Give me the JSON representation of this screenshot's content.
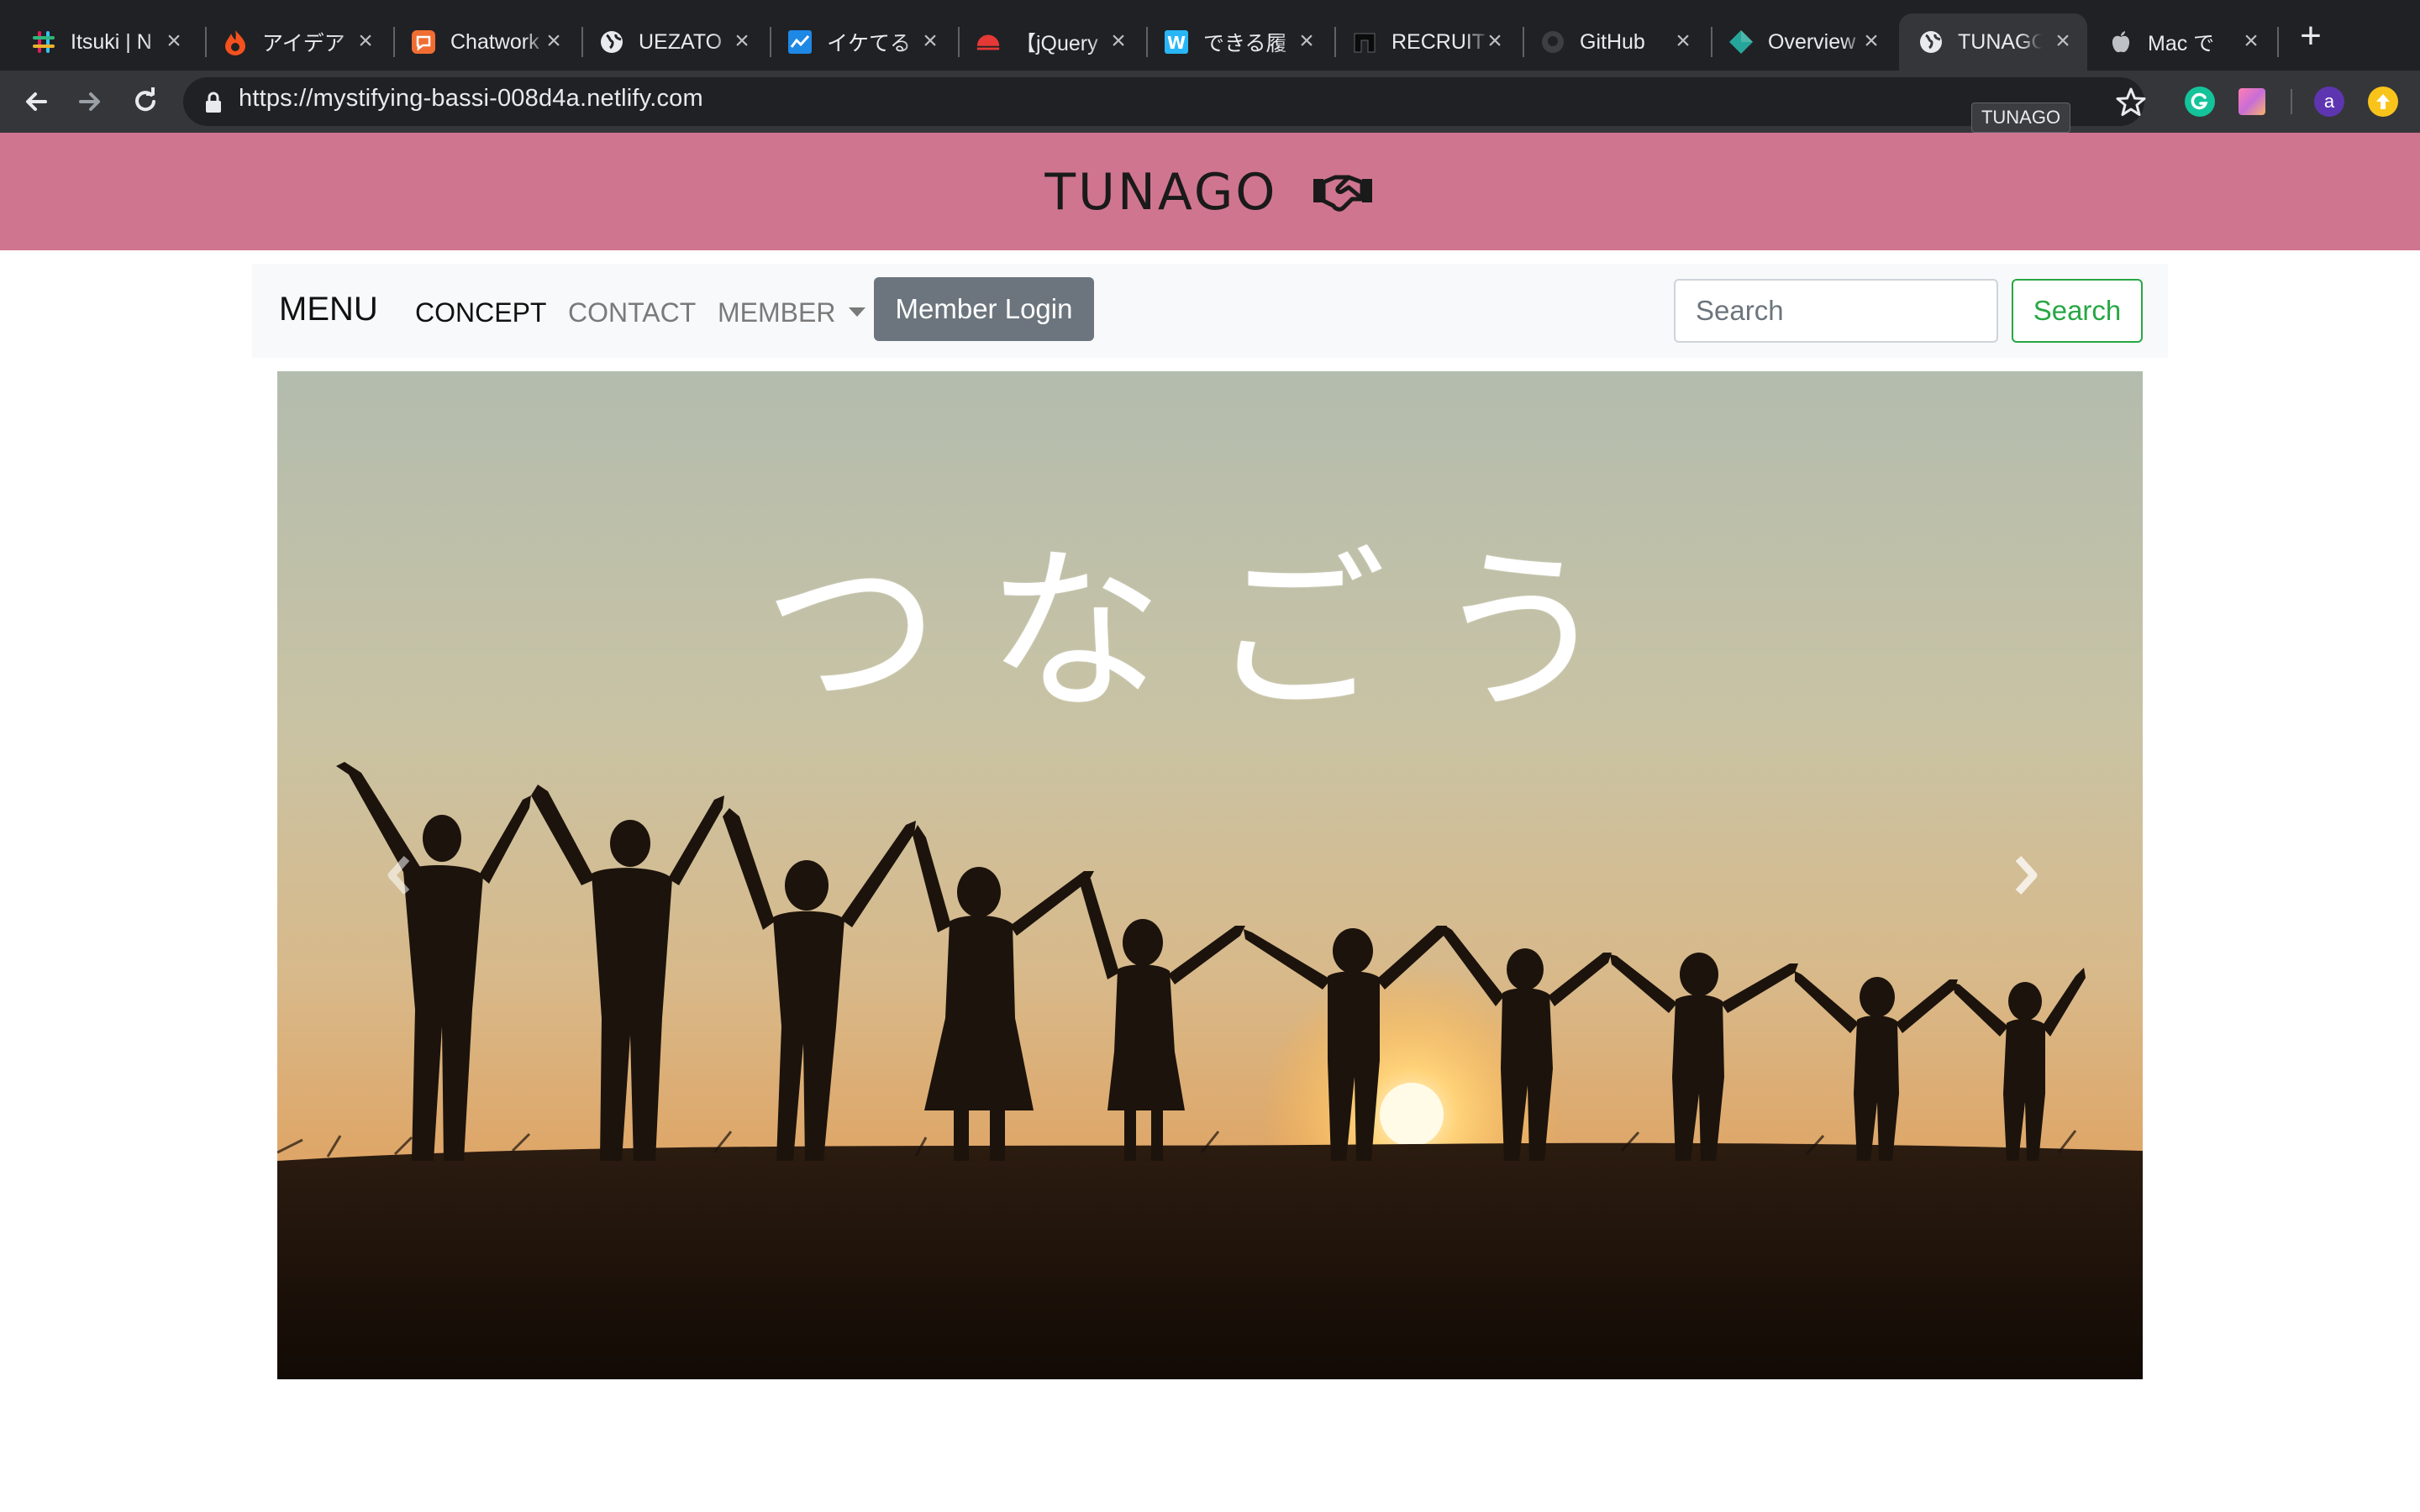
{
  "browser": {
    "tabs": [
      {
        "title": "Itsuki | N",
        "icon": "slack-icon"
      },
      {
        "title": "アイデア",
        "icon": "flame-icon"
      },
      {
        "title": "Chatwork",
        "icon": "chatwork-icon"
      },
      {
        "title": "UEZATO",
        "icon": "globe-icon"
      },
      {
        "title": "イケてる",
        "icon": "chart-icon"
      },
      {
        "title": "【jQuery",
        "icon": "sun-icon"
      },
      {
        "title": "できる履",
        "icon": "w-icon"
      },
      {
        "title": "RECRUIT",
        "icon": "bookmark-icon"
      },
      {
        "title": "GitHub",
        "icon": "github-icon"
      },
      {
        "title": "Overview",
        "icon": "diamond-icon"
      },
      {
        "title": "TUNAGO",
        "icon": "globe-icon"
      },
      {
        "title": "Mac で",
        "icon": "apple-icon"
      }
    ],
    "active_tab": 10,
    "url_host": "https://mystifying-bassi-008d4a.netlify.com",
    "tooltip": "TUNAGO",
    "profile_initial": "a"
  },
  "site": {
    "brand": "TUNAGO",
    "brand_color": "#d07590",
    "nav": {
      "menu_label": "MENU",
      "concept": "CONCEPT",
      "contact": "CONTACT",
      "member": "MEMBER",
      "login": "Member Login"
    },
    "search": {
      "placeholder": "Search",
      "button": "Search"
    },
    "hero": {
      "title": "つなごう"
    }
  }
}
